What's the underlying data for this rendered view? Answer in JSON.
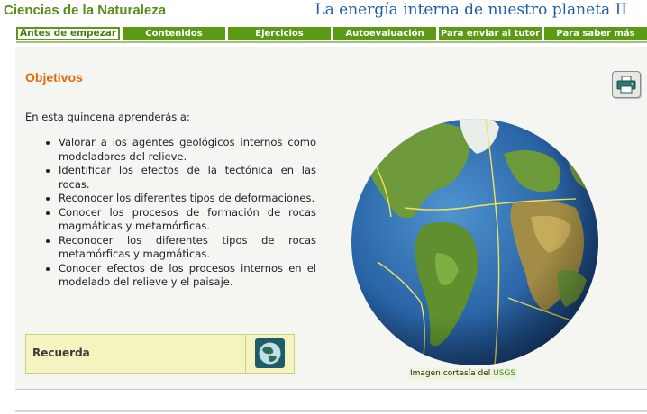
{
  "header": {
    "subject": "Ciencias de la Naturaleza",
    "unit_title": "La energía interna de nuestro planeta II"
  },
  "nav": {
    "tabs": [
      {
        "label": "Antes de empezar",
        "active": true
      },
      {
        "label": "Contenidos",
        "active": false
      },
      {
        "label": "Ejercicios",
        "active": false
      },
      {
        "label": "Autoevaluación",
        "active": false
      },
      {
        "label": "Para enviar al tutor",
        "active": false
      },
      {
        "label": "Para saber más",
        "active": false
      }
    ]
  },
  "main": {
    "title": "Objetivos",
    "intro": "En esta quincena aprenderás a:",
    "objectives": [
      "Valorar a los agentes geológicos internos como modeladores del relieve.",
      "Identificar los efectos de la tectónica en las rocas.",
      "Reconocer los diferentes tipos de deformaciones.",
      "Conocer los procesos de formación de rocas magmáticas y metamórficas.",
      "Reconocer los diferentes tipos de rocas metamórficas y magmáticas.",
      "Conocer efectos de los procesos internos en el modelado del relieve y el paisaje."
    ],
    "recuerda_label": "Recuerda",
    "image_caption": "Imagen cortesía del",
    "image_caption_link": "USGS"
  },
  "icons": {
    "print": "printer-icon",
    "recuerda": "globe-icon"
  },
  "colors": {
    "nav_green": "#5a9a14",
    "title_orange": "#e06a0c",
    "subject_green": "#5a8c1a",
    "unit_blue": "#1f5ea8"
  }
}
